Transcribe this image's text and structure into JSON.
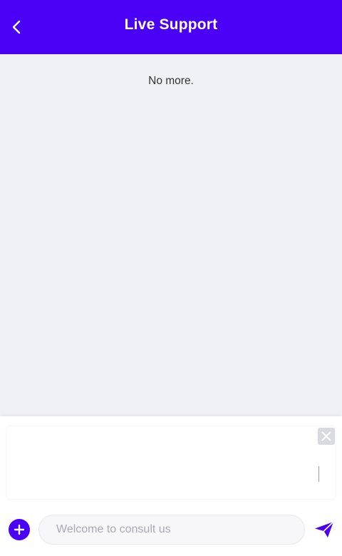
{
  "header": {
    "title": "Live Support",
    "back_icon": "chevron-left-icon",
    "bg_color": "#4a00f5"
  },
  "messages": {
    "status_text": "No more."
  },
  "composer": {
    "input_placeholder": "Welcome to consult us",
    "input_value": "",
    "add_icon": "plus-icon",
    "send_icon": "paper-plane-icon",
    "close_icon": "close-icon",
    "accent_color": "#4a00f5"
  }
}
